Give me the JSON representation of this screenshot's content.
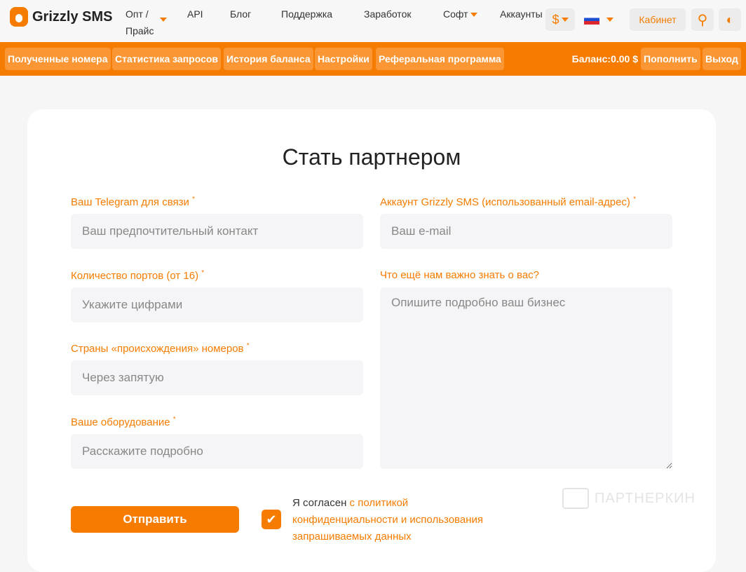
{
  "header": {
    "brand": "Grizzly SMS",
    "nav": [
      "Опт / Прайс",
      "API",
      "Блог",
      "Поддержка",
      "Заработок",
      "Софт",
      "Аккаунты"
    ],
    "currency": "$",
    "cabinet": "Кабинет"
  },
  "subnav": {
    "items": [
      "Полученные номера",
      "Статистика запросов",
      "История баланса",
      "Настройки",
      "Реферальная программа"
    ],
    "balance": "Баланс:0.00 $",
    "topup": "Пополнить",
    "logout": "Выход"
  },
  "form": {
    "title": "Стать партнером",
    "telegram_label": "Ваш Telegram для связи",
    "telegram_ph": "Ваш предпочтительный контакт",
    "account_label": "Аккаунт Grizzly SMS (использованный email-адрес)",
    "account_ph": "Ваш e-mail",
    "ports_label": "Количество портов (от 16)",
    "ports_ph": "Укажите цифрами",
    "about_label": "Что ещё нам важно знать о вас?",
    "about_ph": "Опишите подробно ваш бизнес",
    "countries_label": "Страны «происхождения» номеров",
    "countries_ph": "Через запятую",
    "equipment_label": "Ваше оборудование",
    "equipment_ph": "Расскажите подробно",
    "required": "*",
    "submit": "Отправить",
    "agree_prefix": "Я согласен ",
    "agree_link": "с политикой конфиденциальности и использования запрашиваемых данных",
    "agree_checked": true
  },
  "watermark": "ПАРТНЕРКИН",
  "colors": {
    "accent": "#f57c00"
  }
}
